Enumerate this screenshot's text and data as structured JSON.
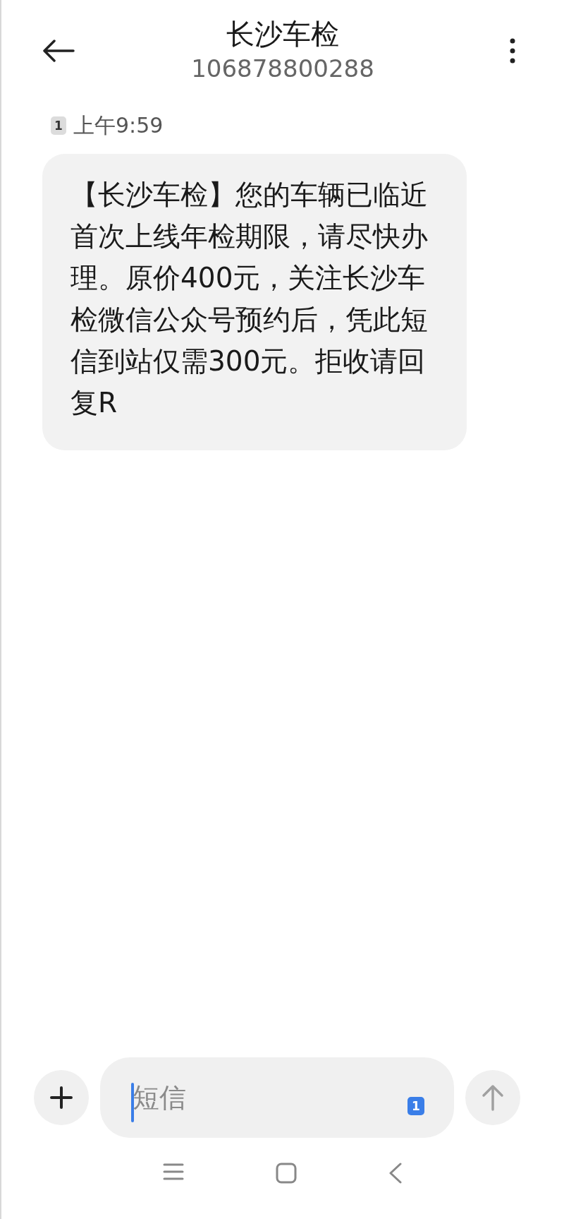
{
  "header": {
    "title": "长沙车检",
    "number": "106878800288"
  },
  "messages": [
    {
      "sim": "1",
      "time": "上午9:59",
      "text": "【长沙车检】您的车辆已临近首次上线年检期限，请尽快办理。原价400元，关注长沙车检微信公众号预约后，凭此短信到站仅需300元。拒收请回复R"
    }
  ],
  "composer": {
    "placeholder": "短信",
    "sim": "1"
  }
}
